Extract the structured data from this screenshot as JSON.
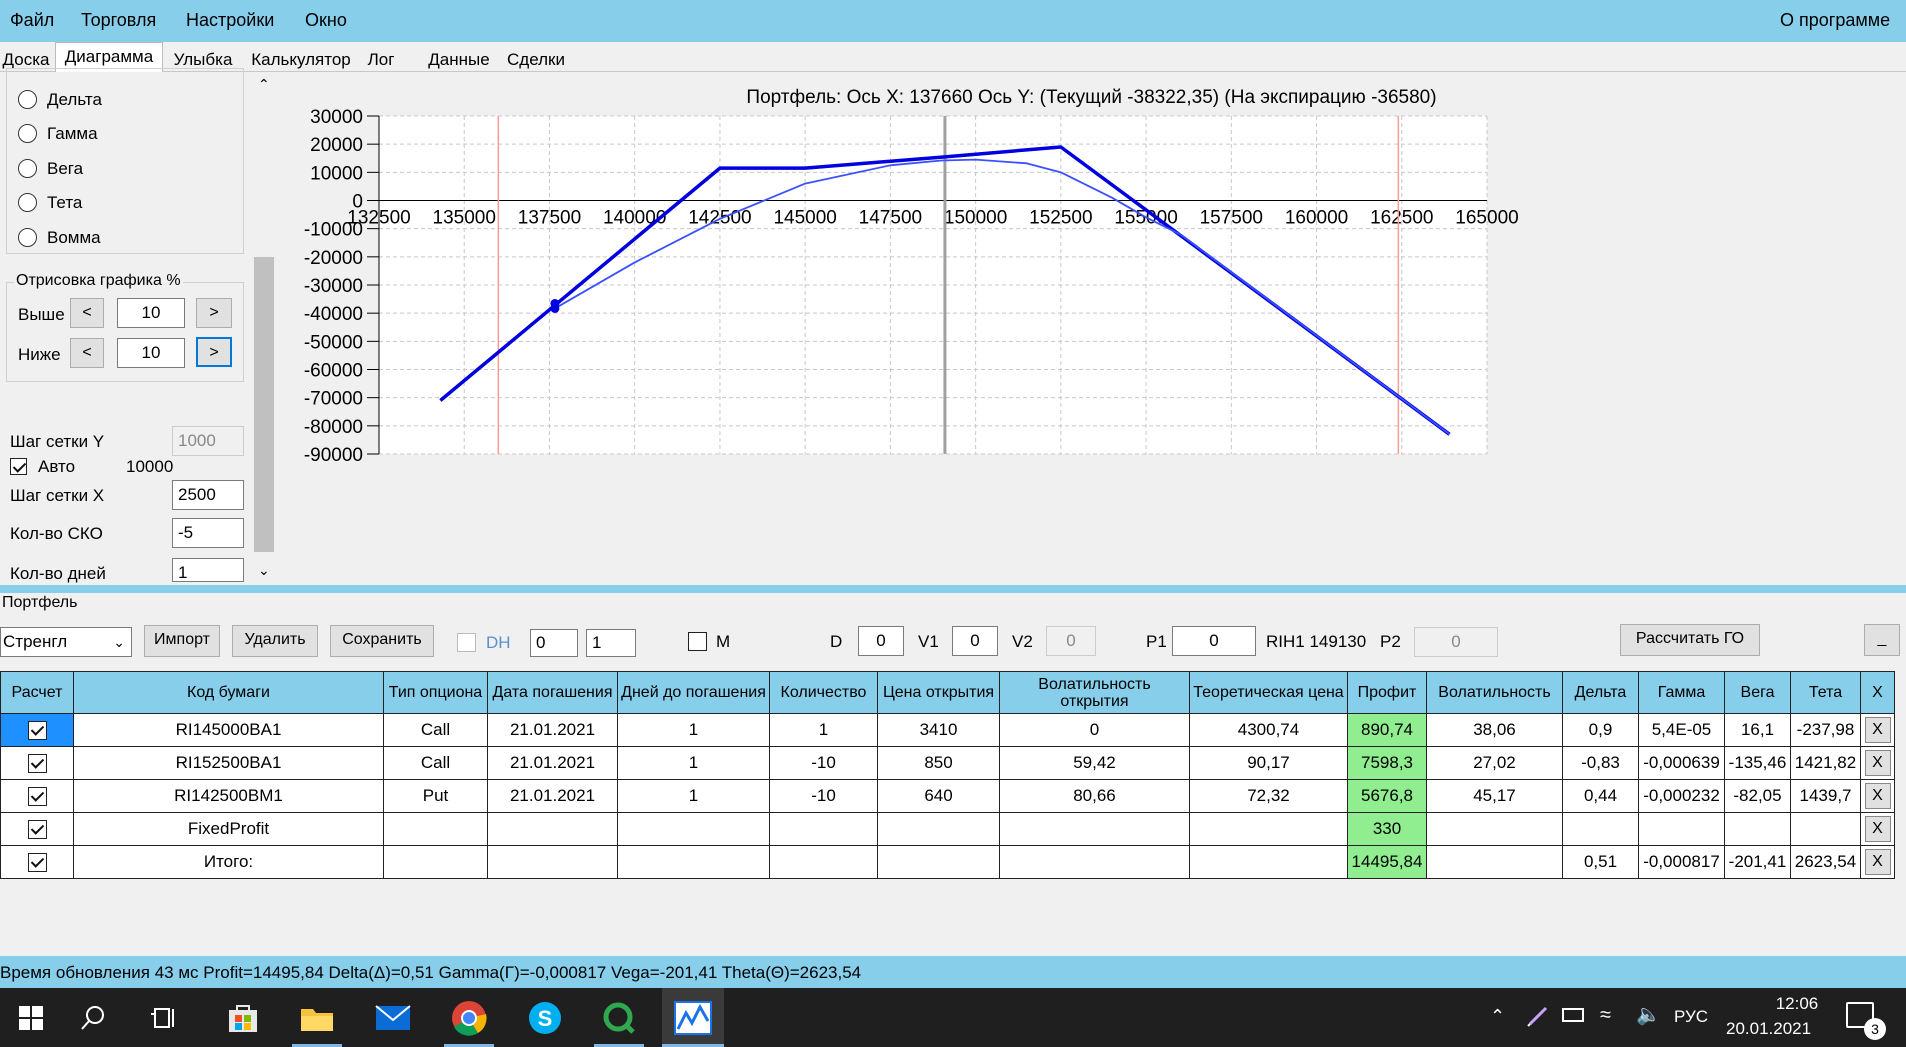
{
  "menu": {
    "items": [
      "Файл",
      "Торговля",
      "Настройки",
      "Окно"
    ],
    "about": "О программе"
  },
  "tabs": [
    "Доска",
    "Диаграмма",
    "Улыбка",
    "Калькулятор",
    "Лог",
    "Данные",
    "Сделки"
  ],
  "left": {
    "radios": [
      "Дельта",
      "Гамма",
      "Вега",
      "Тета",
      "Вомма"
    ],
    "draw_group": "Отрисовка графика %",
    "above_label": "Выше",
    "above_value": "10",
    "below_label": "Ниже",
    "below_value": "10",
    "prev_btn": "<",
    "next_btn": ">",
    "grid_y_label": "Шаг сетки Y",
    "grid_y_value": "1000",
    "auto_label": "Авто",
    "auto_value": "10000",
    "grid_x_label": "Шаг сетки X",
    "grid_x_value": "2500",
    "sko_label": "Кол-во СКО",
    "sko_value": "-5",
    "days_label": "Кол-во дней",
    "days_value": "1"
  },
  "chart_data": {
    "type": "line",
    "title": "Портфель: Ось X: 137660 Ось Y:  (Текущий -38322,35)  (На экспирацию -36580)",
    "xlim": [
      132500,
      165000
    ],
    "ylim": [
      -90000,
      30000
    ],
    "x_ticks": [
      "132500",
      "135000",
      "137500",
      "140000",
      "142500",
      "145000",
      "147500",
      "150000",
      "152500",
      "155000",
      "157500",
      "160000",
      "162500",
      "165000"
    ],
    "y_ticks": [
      "30000",
      "20000",
      "10000",
      "0",
      "-10000",
      "-20000",
      "-30000",
      "-40000",
      "-50000",
      "-60000",
      "-70000",
      "-80000",
      "-90000"
    ],
    "grid": true,
    "vertical_lines": [
      {
        "x": 136000,
        "color": "#ff9999"
      },
      {
        "x": 149100,
        "color": "#a0a0a0"
      },
      {
        "x": 162400,
        "color": "#ff9999"
      }
    ],
    "marker": {
      "x": 137660,
      "y": [
        -36580,
        -38322.35
      ]
    },
    "series": [
      {
        "style": "expiration",
        "color": "#0000e0",
        "points": [
          [
            134300,
            -71000
          ],
          [
            142500,
            11500
          ],
          [
            145000,
            11500
          ],
          [
            149100,
            15500
          ],
          [
            152500,
            19000
          ],
          [
            163900,
            -83000
          ]
        ]
      },
      {
        "style": "current",
        "color": "#3a50ff",
        "points": [
          [
            137660,
            -38322
          ],
          [
            140000,
            -22000
          ],
          [
            142500,
            -6500
          ],
          [
            145000,
            6000
          ],
          [
            147500,
            12500
          ],
          [
            149000,
            14200
          ],
          [
            150000,
            14500
          ],
          [
            151500,
            13200
          ],
          [
            152500,
            10000
          ],
          [
            154000,
            1000
          ],
          [
            155000,
            -6000
          ],
          [
            156000,
            -12000
          ],
          [
            163900,
            -83000
          ]
        ]
      }
    ]
  },
  "portfolio": {
    "label": "Портфель",
    "combo": "Стренгл",
    "btn_import": "Импорт",
    "btn_delete": "Удалить",
    "btn_save": "Сохранить",
    "dh_label": "DH",
    "spin1": "0",
    "spin2": "1",
    "m_label": "M",
    "d_label": "D",
    "d_value": "0",
    "v1_label": "V1",
    "v1_value": "0",
    "v2_label": "V2",
    "v2_value": "0",
    "p1_label": "P1",
    "p1_value": "0",
    "instrument": "RIH1 149130",
    "p2_label": "P2",
    "p2_value": "0",
    "btn_go": "Рассчитать ГО",
    "btn_min": "_"
  },
  "table": {
    "headers": [
      "Расчет",
      "Код бумаги",
      "Тип опциона",
      "Дата погашения",
      "Дней до погашения",
      "Количество",
      "Цена открытия",
      "Волатильность открытия",
      "Теоретическая цена",
      "Профит",
      "Волатильность",
      "Дельта",
      "Гамма",
      "Вега",
      "Тета",
      "X"
    ],
    "rows": [
      {
        "code": "RI145000BA1",
        "type": "Call",
        "date": "21.01.2021",
        "days": "1",
        "qty": "1",
        "price": "3410",
        "vol_open": "0",
        "theo": "4300,74",
        "profit": "890,74",
        "vol": "38,06",
        "delta": "0,9",
        "gamma": "5,4E-05",
        "vega": "16,1",
        "theta": "-237,98",
        "x": "X"
      },
      {
        "code": "RI152500BA1",
        "type": "Call",
        "date": "21.01.2021",
        "days": "1",
        "qty": "-10",
        "price": "850",
        "vol_open": "59,42",
        "theo": "90,17",
        "profit": "7598,3",
        "vol": "27,02",
        "delta": "-0,83",
        "gamma": "-0,000639",
        "vega": "-135,46",
        "theta": "1421,82",
        "x": "X"
      },
      {
        "code": "RI142500BM1",
        "type": "Put",
        "date": "21.01.2021",
        "days": "1",
        "qty": "-10",
        "price": "640",
        "vol_open": "80,66",
        "theo": "72,32",
        "profit": "5676,8",
        "vol": "45,17",
        "delta": "0,44",
        "gamma": "-0,000232",
        "vega": "-82,05",
        "theta": "1439,7",
        "x": "X"
      },
      {
        "code": "FixedProfit",
        "type": "",
        "date": "",
        "days": "",
        "qty": "",
        "price": "",
        "vol_open": "",
        "theo": "",
        "profit": "330",
        "vol": "",
        "delta": "",
        "gamma": "",
        "vega": "",
        "theta": "",
        "x": "X"
      },
      {
        "code": "Итого:",
        "type": "",
        "date": "",
        "days": "",
        "qty": "",
        "price": "",
        "vol_open": "",
        "theo": "",
        "profit": "14495,84",
        "vol": "",
        "delta": "0,51",
        "gamma": "-0,000817",
        "vega": "-201,41",
        "theta": "2623,54",
        "x": "X"
      }
    ]
  },
  "status": "Время обновления 43 мс  Profit=14495,84 Delta(Δ)=0,51 Gamma(Γ)=-0,000817 Vega=-201,41 Theta(Θ)=2623,54",
  "taskbar": {
    "lang": "РУС",
    "time": "12:06",
    "date": "20.01.2021",
    "notif": "3"
  }
}
